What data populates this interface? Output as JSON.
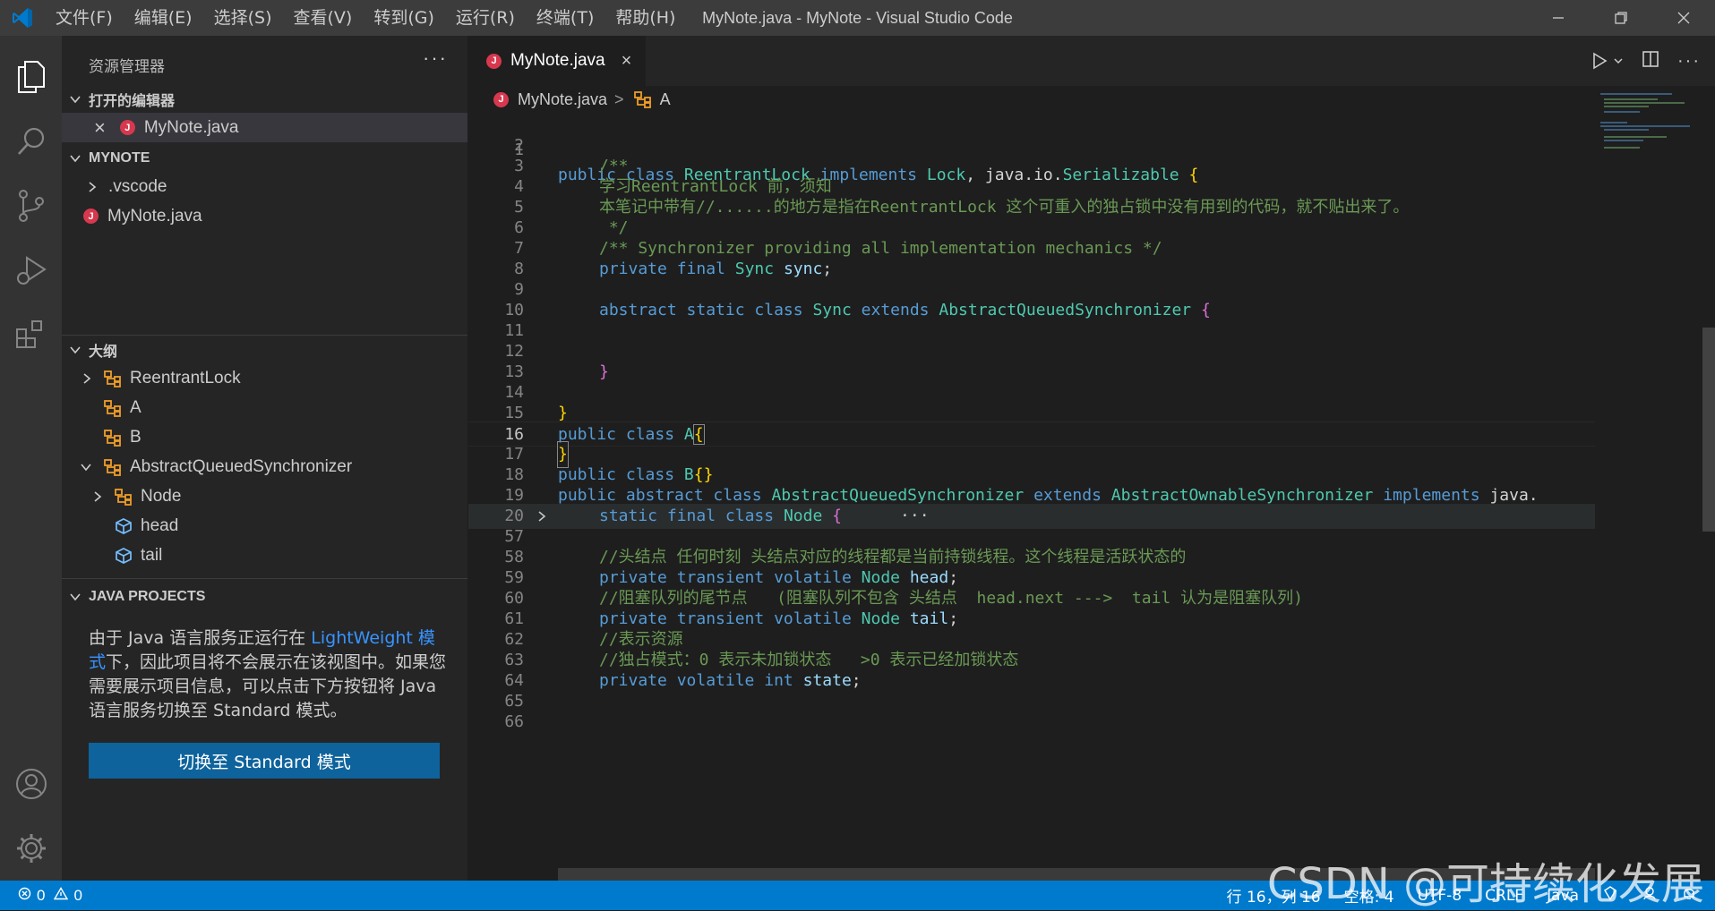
{
  "titlebar": {
    "menus": [
      "文件(F)",
      "编辑(E)",
      "选择(S)",
      "查看(V)",
      "转到(G)",
      "运行(R)",
      "终端(T)",
      "帮助(H)"
    ],
    "window_title": "MyNote.java - MyNote - Visual Studio Code"
  },
  "sidebar": {
    "title": "资源管理器",
    "more": "···",
    "open_editors": {
      "title": "打开的编辑器",
      "file": "MyNote.java",
      "close": "×"
    },
    "workspace": {
      "title": "MYNOTE",
      "folder": ".vscode",
      "file": "MyNote.java"
    },
    "outline": {
      "title": "大纲",
      "items": [
        "ReentrantLock",
        "A",
        "B",
        "AbstractQueuedSynchronizer",
        "Node",
        "head",
        "tail"
      ]
    },
    "java_projects": {
      "title": "JAVA PROJECTS",
      "msg_1": "由于 Java 语言服务正运行在 ",
      "msg_link": "LightWeight 模式",
      "msg_2": "下，因此项目将不会展示在该视图中。如果您需要展示项目信息，可以点击下方按钮将 Java 语言服务切换至 Standard 模式。",
      "button": "切换至 Standard 模式"
    }
  },
  "editor": {
    "tab": {
      "label": "MyNote.java",
      "close": "×"
    },
    "breadcrumb": {
      "file": "MyNote.java",
      "sep": ">",
      "symbol": "A"
    },
    "line_numbers": [
      "1",
      "2",
      "3",
      "4",
      "5",
      "6",
      "7",
      "8",
      "9",
      "10",
      "11",
      "12",
      "13",
      "14",
      "15",
      "16",
      "17",
      "18",
      "19",
      "20",
      "57",
      "58",
      "59",
      "60",
      "61",
      "62",
      "63",
      "64",
      "65",
      "66"
    ],
    "current_line": "16",
    "lines": {
      "l1": {
        "k1": "public",
        "k2": "class",
        "t1": "ReentrantLock",
        "k3": "implements",
        "t2": "Lock",
        "p1": ", java.io.",
        "t3": "Serializable",
        "b": "{"
      },
      "l3": "/**",
      "l4": "学习ReentrantLock 前，须知",
      "l5": "本笔记中带有//......的地方是指在ReentrantLock 这个可重入的独占锁中没有用到的代码，就不贴出来了。",
      "l6": " */",
      "l7": "/** Synchronizer providing all implementation mechanics */",
      "l8": {
        "k1": "private",
        "k2": "final",
        "t": "Sync",
        "id": "sync",
        "p": ";"
      },
      "l10": {
        "k1": "abstract",
        "k2": "static",
        "k3": "class",
        "t1": "Sync",
        "k4": "extends",
        "t2": "AbstractQueuedSynchronizer",
        "b": "{"
      },
      "l13": "}",
      "l15": "}",
      "l16": {
        "k1": "public",
        "k2": "class",
        "t": "A",
        "b": "{"
      },
      "l17": "}",
      "l18": {
        "k1": "public",
        "k2": "class",
        "t": "B",
        "b": "{}"
      },
      "l19": {
        "k1": "public",
        "k2": "abstract",
        "k3": "class",
        "t1": "AbstractQueuedSynchronizer",
        "k4": "extends",
        "t2": "AbstractOwnableSynchronizer",
        "k5": "implements",
        "p": "java."
      },
      "l20": {
        "k1": "static",
        "k2": "final",
        "k3": "class",
        "t": "Node",
        "b": "{",
        "ell": "···"
      },
      "l58": "//头结点 任何时刻 头结点对应的线程都是当前持锁线程。这个线程是活跃状态的",
      "l59": {
        "k1": "private",
        "k2": "transient",
        "k3": "volatile",
        "t": "Node",
        "id": "head",
        "p": ";"
      },
      "l60": "//阻塞队列的尾节点   (阻塞队列不包含 头结点  head.next --->  tail 认为是阻塞队列)",
      "l61": {
        "k1": "private",
        "k2": "transient",
        "k3": "volatile",
        "t": "Node",
        "id": "tail",
        "p": ";"
      },
      "l62": "//表示资源",
      "l63": "//独占模式：0 表示未加锁状态   >0 表示已经加锁状态",
      "l64": {
        "k1": "private",
        "k2": "volatile",
        "k3": "int",
        "id": "state",
        "p": ";"
      }
    }
  },
  "statusbar": {
    "errors": "0",
    "warnings": "0",
    "position": "行 16，列 16",
    "spaces": "空格: 4",
    "encoding": "UTF-8",
    "eol": "CRLF",
    "language": "Java"
  },
  "watermark": "CSDN @可持续化发展"
}
